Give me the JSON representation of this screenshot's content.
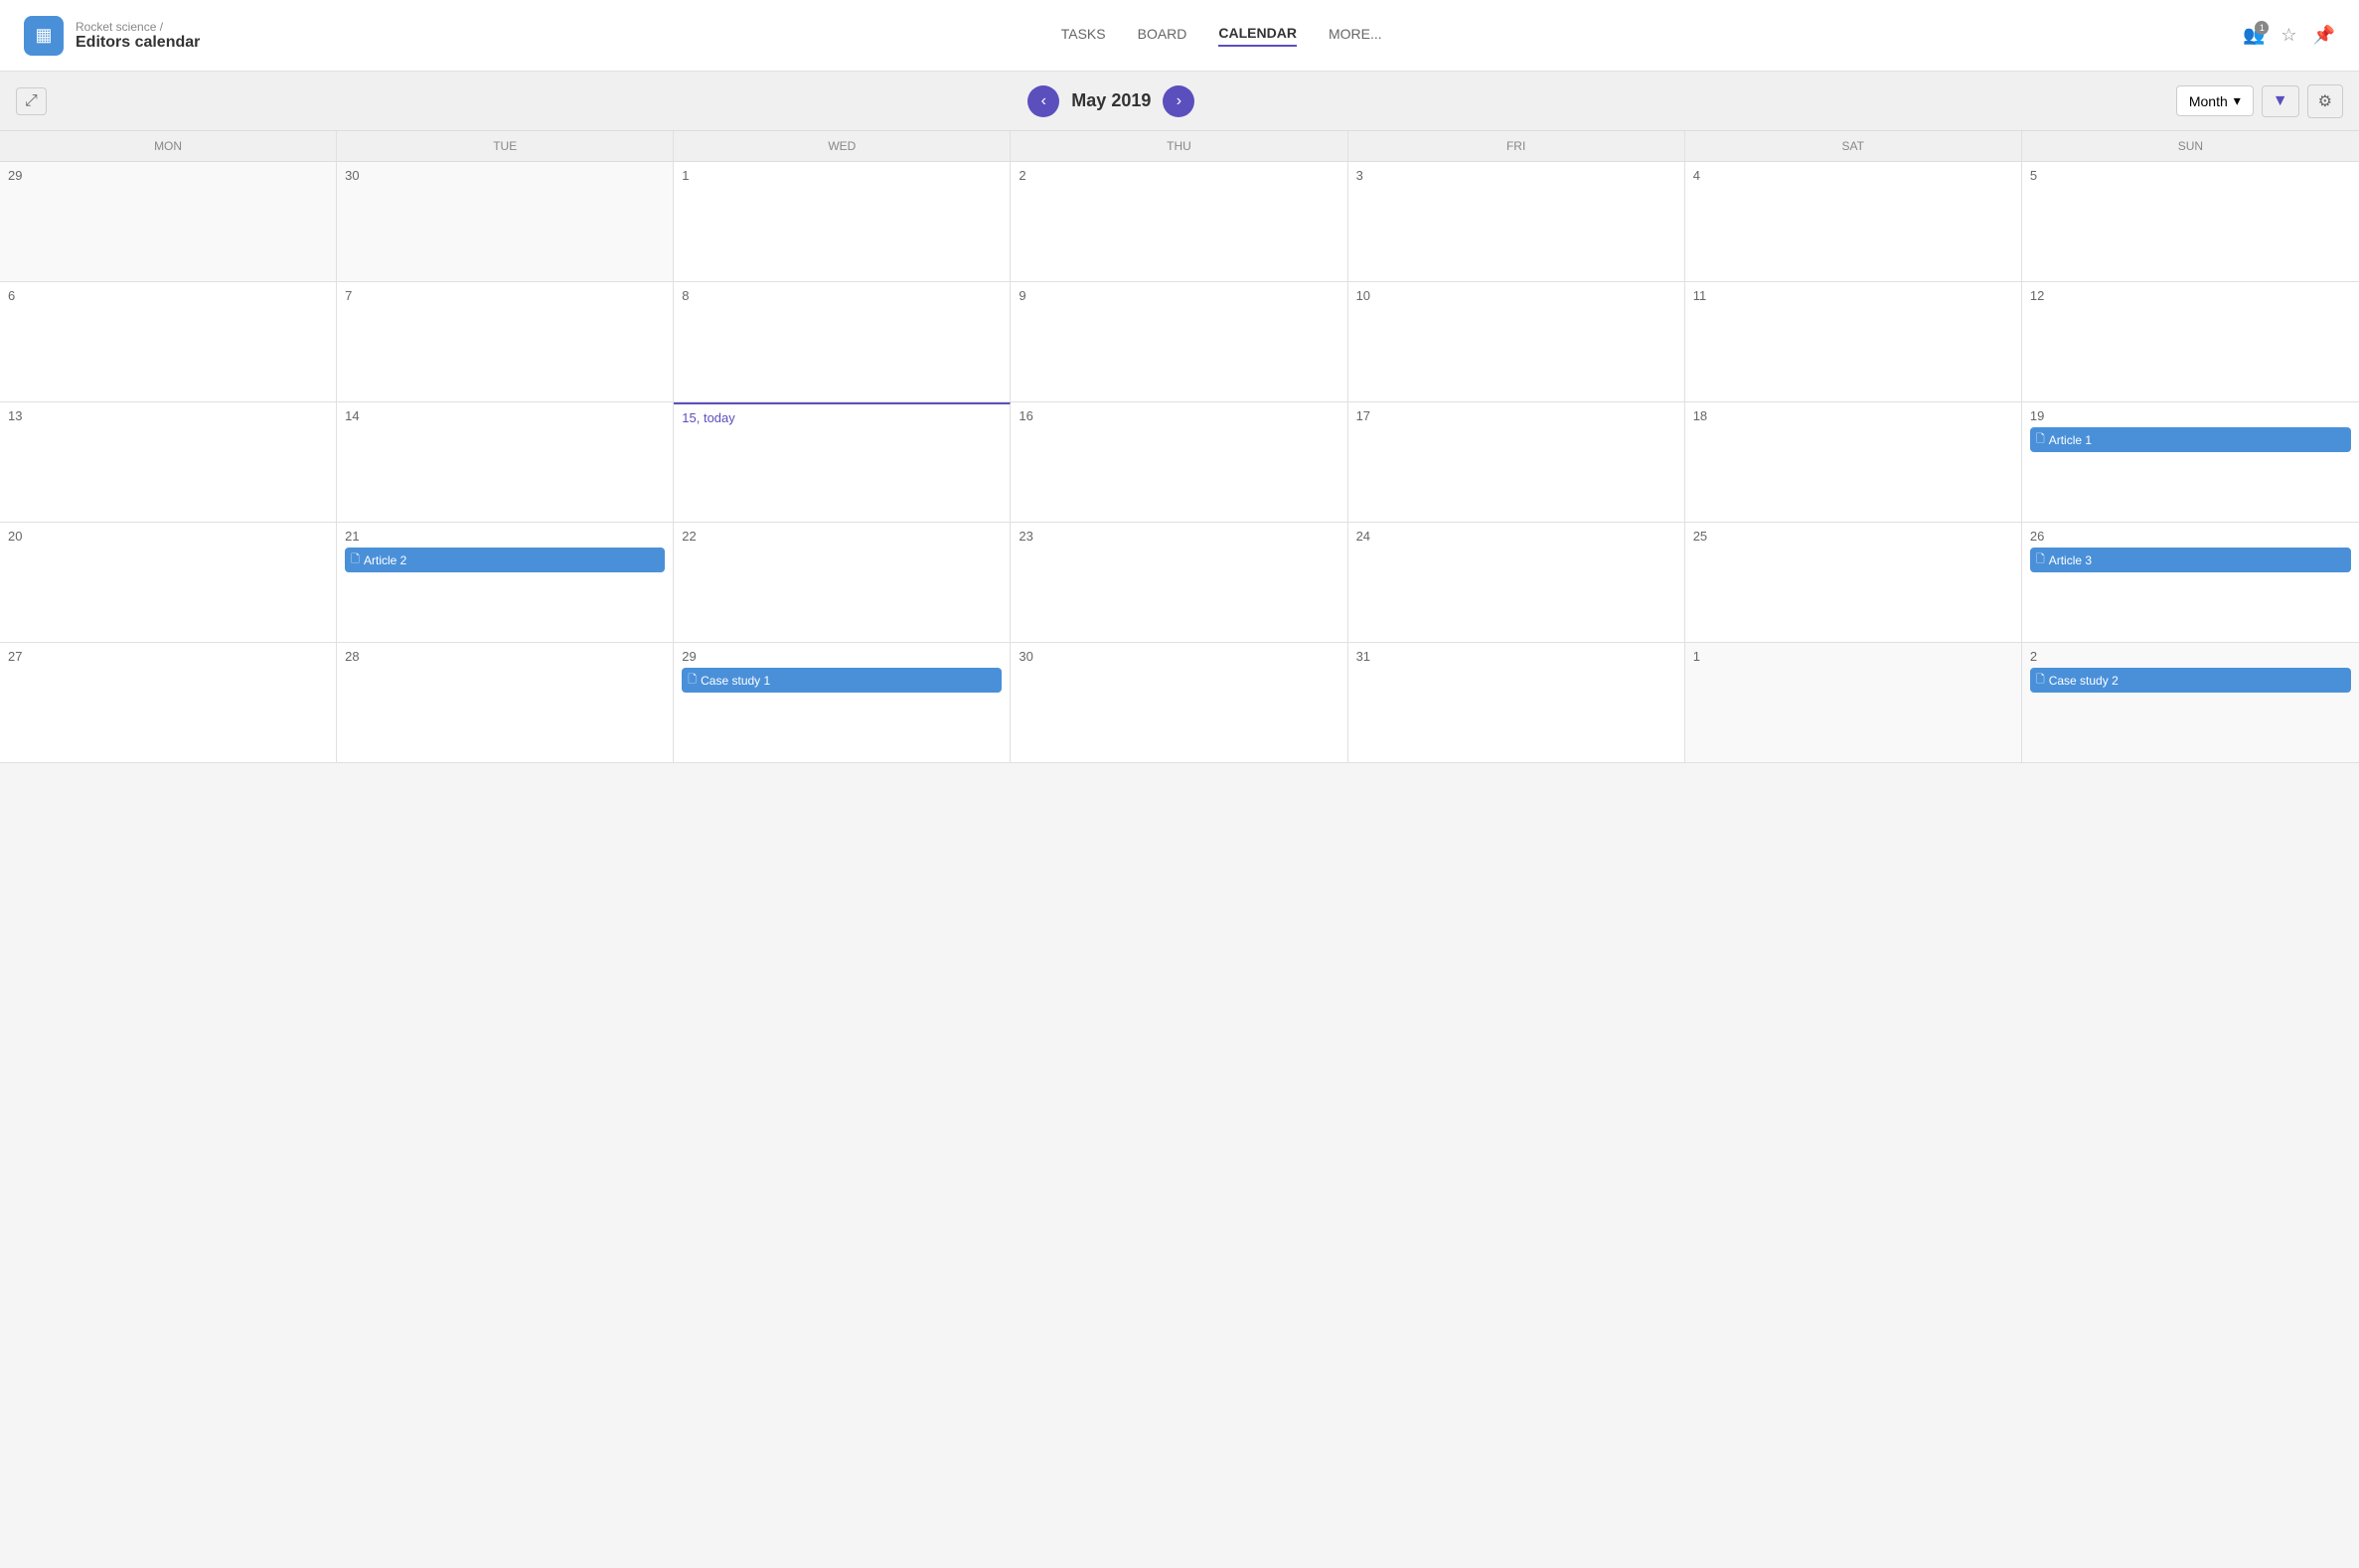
{
  "header": {
    "breadcrumb": "Rocket science /",
    "title": "Editors calendar",
    "nav": [
      {
        "id": "tasks",
        "label": "TASKS",
        "active": false
      },
      {
        "id": "board",
        "label": "BOARD",
        "active": false
      },
      {
        "id": "calendar",
        "label": "CALENDAR",
        "active": true
      },
      {
        "id": "more",
        "label": "MORE...",
        "active": false
      }
    ],
    "badge_count": "1"
  },
  "toolbar": {
    "month_title": "May 2019",
    "view_label": "Month",
    "prev_icon": "‹",
    "next_icon": "›"
  },
  "day_headers": [
    "MON",
    "TUE",
    "WED",
    "THU",
    "FRI",
    "SAT",
    "SUN"
  ],
  "weeks": [
    {
      "days": [
        {
          "num": "29",
          "other": true,
          "today": false,
          "events": []
        },
        {
          "num": "30",
          "other": true,
          "today": false,
          "events": []
        },
        {
          "num": "1",
          "other": false,
          "today": false,
          "events": []
        },
        {
          "num": "2",
          "other": false,
          "today": false,
          "events": []
        },
        {
          "num": "3",
          "other": false,
          "today": false,
          "events": []
        },
        {
          "num": "4",
          "other": false,
          "today": false,
          "events": []
        },
        {
          "num": "5",
          "other": false,
          "today": false,
          "events": []
        }
      ]
    },
    {
      "days": [
        {
          "num": "6",
          "other": false,
          "today": false,
          "events": []
        },
        {
          "num": "7",
          "other": false,
          "today": false,
          "events": []
        },
        {
          "num": "8",
          "other": false,
          "today": false,
          "events": []
        },
        {
          "num": "9",
          "other": false,
          "today": false,
          "events": []
        },
        {
          "num": "10",
          "other": false,
          "today": false,
          "events": []
        },
        {
          "num": "11",
          "other": false,
          "today": false,
          "events": []
        },
        {
          "num": "12",
          "other": false,
          "today": false,
          "events": []
        }
      ]
    },
    {
      "days": [
        {
          "num": "13",
          "other": false,
          "today": false,
          "events": []
        },
        {
          "num": "14",
          "other": false,
          "today": false,
          "events": []
        },
        {
          "num": "15, today",
          "other": false,
          "today": true,
          "events": []
        },
        {
          "num": "16",
          "other": false,
          "today": false,
          "events": []
        },
        {
          "num": "17",
          "other": false,
          "today": false,
          "events": []
        },
        {
          "num": "18",
          "other": false,
          "today": false,
          "events": []
        },
        {
          "num": "19",
          "other": false,
          "today": false,
          "events": [
            {
              "label": "Article 1",
              "icon": "📄"
            }
          ]
        }
      ]
    },
    {
      "days": [
        {
          "num": "20",
          "other": false,
          "today": false,
          "events": []
        },
        {
          "num": "21",
          "other": false,
          "today": false,
          "events": [
            {
              "label": "Article 2",
              "icon": "📄"
            }
          ]
        },
        {
          "num": "22",
          "other": false,
          "today": false,
          "events": []
        },
        {
          "num": "23",
          "other": false,
          "today": false,
          "events": []
        },
        {
          "num": "24",
          "other": false,
          "today": false,
          "events": []
        },
        {
          "num": "25",
          "other": false,
          "today": false,
          "events": []
        },
        {
          "num": "26",
          "other": false,
          "today": false,
          "events": [
            {
              "label": "Article 3",
              "icon": "📄"
            }
          ]
        }
      ]
    },
    {
      "days": [
        {
          "num": "27",
          "other": false,
          "today": false,
          "events": []
        },
        {
          "num": "28",
          "other": false,
          "today": false,
          "events": []
        },
        {
          "num": "29",
          "other": false,
          "today": false,
          "events": [
            {
              "label": "Case study 1",
              "icon": "📄"
            }
          ]
        },
        {
          "num": "30",
          "other": false,
          "today": false,
          "events": []
        },
        {
          "num": "31",
          "other": false,
          "today": false,
          "events": []
        },
        {
          "num": "1",
          "other": true,
          "today": false,
          "events": []
        },
        {
          "num": "2",
          "other": true,
          "today": false,
          "events": [
            {
              "label": "Case study 2",
              "icon": "📄"
            }
          ]
        }
      ]
    }
  ],
  "icons": {
    "app": "▦",
    "expand": "⤢",
    "filter": "▼",
    "settings": "⚙",
    "people": "👥",
    "star": "☆",
    "pin": "📌",
    "chevron_down": "▾",
    "doc": "🗋"
  }
}
